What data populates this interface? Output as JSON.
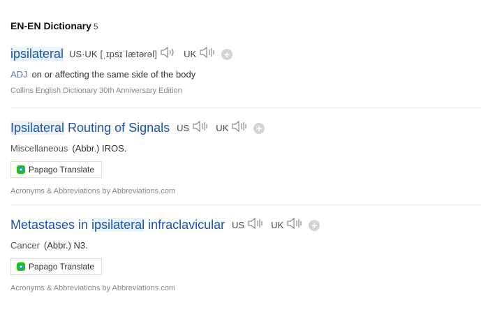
{
  "section": {
    "title": "EN-EN Dictionary",
    "count": "5"
  },
  "entries": [
    {
      "word": "ipsilateral",
      "pron_label": "US·UK",
      "phonetic": "[ˌɪpsɪˈlætərəl]",
      "uk_label": "UK",
      "pos": "ADJ",
      "definition": "on or affecting the same side of the body",
      "source": "Collins English Dictionary 30th Anniversary Edition"
    },
    {
      "word_highlight": "Ipsilateral",
      "word_rest": " Routing of Signals",
      "us_label": "US",
      "uk_label": "UK",
      "category": "Miscellaneous",
      "abbr": "(Abbr.) IROS.",
      "translate_label": "Papago Translate",
      "source": "Acronyms & Abbreviations by Abbreviations.com"
    },
    {
      "word_pre": "Metastases in ",
      "word_highlight": "ipsilateral",
      "word_rest": " infraclavicular",
      "us_label": "US",
      "uk_label": "UK",
      "category": "Cancer",
      "abbr": "(Abbr.) N3.",
      "translate_label": "Papago Translate",
      "source": "Acronyms & Abbreviations by Abbreviations.com"
    }
  ],
  "icons": {
    "speaker": "speaker-icon",
    "add": "add-icon",
    "papago": "papago-icon"
  },
  "colors": {
    "link": "#1d52b3",
    "highlight": "#e8f3fb",
    "pos": "#5a7ab8"
  }
}
